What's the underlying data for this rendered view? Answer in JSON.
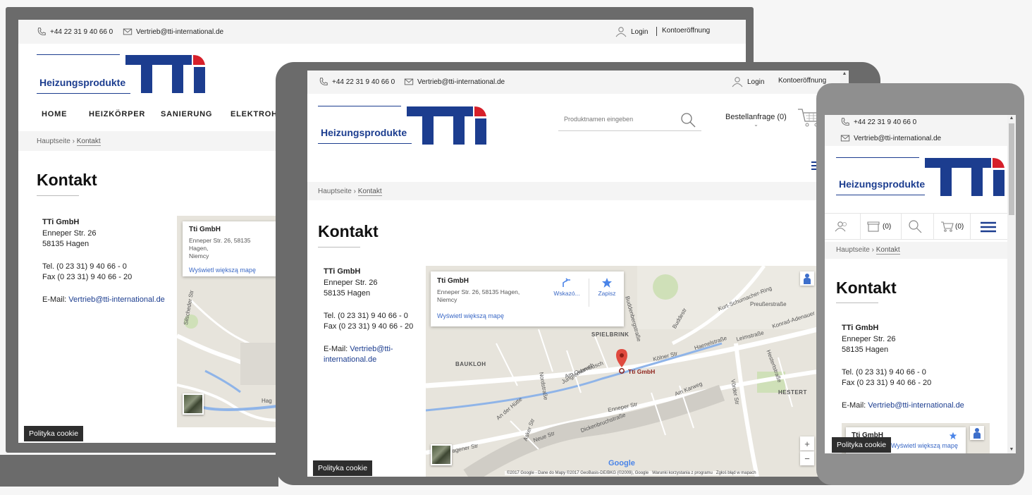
{
  "site": {
    "phone": "+44 22 31 9 40 66 0",
    "email": "Vertrieb@tti-international.de",
    "login": "Login",
    "register": "Kontoeröffnung",
    "logo_word": "Heizungsprodukte",
    "search_placeholder": "Produktnamen eingeben",
    "order_request": "Bestellanfrage (0)",
    "cart_count": "(0)",
    "wishlist_count": "(0)",
    "cookie_label": "Polityka cookie"
  },
  "nav": {
    "items": [
      {
        "label": "HOME"
      },
      {
        "label": "HEIZKÖRPER"
      },
      {
        "label": "SANIERUNG"
      },
      {
        "label": "ELEKTROHE"
      }
    ]
  },
  "breadcrumb": {
    "home": "Hauptseite",
    "separator": "›",
    "current": "Kontakt"
  },
  "page": {
    "title": "Kontakt"
  },
  "contact": {
    "company": "TTi GmbH",
    "street": "Enneper Str. 26",
    "city": "58135 Hagen",
    "tel": "Tel. (0 23 31) 9 40 66 - 0",
    "fax": "Fax (0 23 31) 9 40 66 - 20",
    "email_label": "E-Mail: ",
    "email": "Vertrieb@tti-international.de",
    "email_part1": "Vertrieb@tti-",
    "email_part2": "international.de"
  },
  "map": {
    "place_name": "Tti GmbH",
    "place_title_short": "Tti GmbH",
    "address_line1": "Enneper Str. 26, 58135 Hagen,",
    "address_line2": "Niemcy",
    "desktop_addr1": "Enneper Str. 26, 58135 Hagen,",
    "desktop_addr2": "Niemcy",
    "larger_map": "Wyświetl większą mapę",
    "directions": "Wskazó...",
    "save": "Zapisz",
    "zoom_in": "+",
    "zoom_out": "−",
    "google": "Google",
    "footer": "©2017 Google - Dane do Mapy ©2017 GeoBasis-DE/BKG (©2009), Google",
    "terms": "Warunki korzystania z programu",
    "report": "Zgłoś błąd w mapach",
    "pin_label": "Tti GmbH",
    "labels": {
      "spielbrink": "SPIELBRINK",
      "baukloh": "BAUKLOH",
      "hestert": "HESTERT",
      "jungfernbruch": "Jungfernbruch",
      "am_quambusch": "Am Quambusch",
      "enneper": "Enneper Str",
      "koelner": "Kölner Str",
      "haenelstr": "Haenelstraße",
      "leimstr": "Leimstraße",
      "konrad": "Konrad-Adenauer",
      "kurt": "Kurt-Schumacher-Ring",
      "preussen": "Preußerstraße",
      "buddenberg": "Buddenbergstraße",
      "buddestr": "Buddestr",
      "am_karweg": "Am Karweg",
      "neue_str": "Neue Str",
      "asker": "Asker Str",
      "dickenbruch": "Dickenbruchstraße",
      "an_der_huette": "An der Hütte",
      "vorder": "Vörder Str",
      "hestertstr": "Hestertstraße",
      "nordstr": "Nordstraße",
      "wagener": "Wagener Str",
      "silscheder": "Silscheder Str",
      "hag": "Hag"
    }
  },
  "colors": {
    "brand_blue": "#1c3d8f",
    "brand_red": "#d6202a",
    "frame_gray": "#6b6b6b",
    "link_blue": "#1c3d8f"
  }
}
